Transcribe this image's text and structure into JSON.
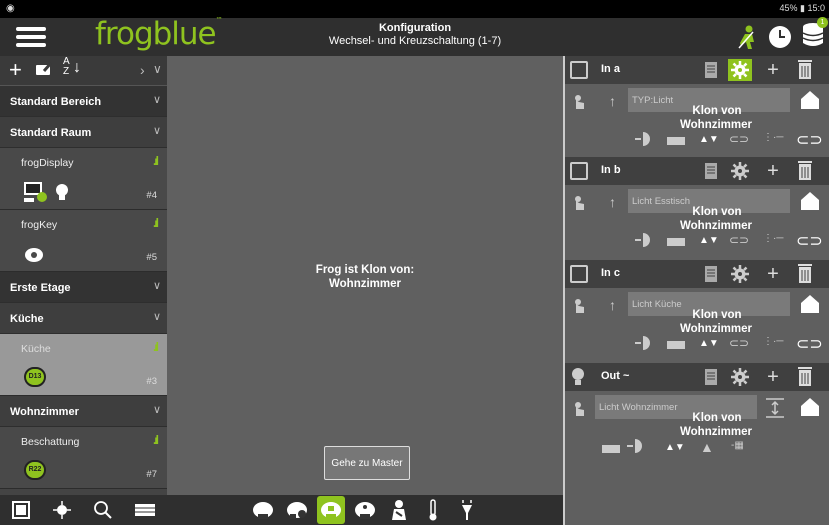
{
  "status": {
    "left_icon": "circle-logo",
    "right": "45% ▮ 15:0"
  },
  "header": {
    "logo": "frogblue",
    "title": "Konfiguration",
    "subtitle": "Wechsel- und Kreuzschaltung (1-7)",
    "badge": "1"
  },
  "sidebar": {
    "sections": [
      {
        "kind": "area",
        "label": "Standard Bereich"
      },
      {
        "kind": "room",
        "label": "Standard Raum"
      },
      {
        "kind": "device",
        "label": "frogDisplay",
        "number": "#4",
        "signal": ".ıl"
      },
      {
        "kind": "device",
        "label": "frogKey",
        "number": "#5",
        "signal": ".ıl"
      },
      {
        "kind": "area",
        "label": "Erste Etage"
      },
      {
        "kind": "room",
        "label": "Küche"
      },
      {
        "kind": "device",
        "label": "Küche",
        "number": "#3",
        "signal": ".ıl",
        "badge": "D13",
        "selected": true
      },
      {
        "kind": "room",
        "label": "Wohnzimmer"
      },
      {
        "kind": "device",
        "label": "Beschattung",
        "number": "#7",
        "signal": ".ıl",
        "badge": "R22"
      }
    ]
  },
  "center": {
    "message_line1": "Frog ist Klon von:",
    "message_line2": "Wohnzimmer",
    "button": "Gehe zu Master"
  },
  "right": {
    "blocks": [
      {
        "name": "In a",
        "field": "TYP:Licht",
        "klon1": "Klon von",
        "klon2": "Wohnzimmer",
        "gear_active": true
      },
      {
        "name": "In b",
        "field": "Licht Esstisch",
        "klon1": "Klon von",
        "klon2": "Wohnzimmer",
        "gear_active": false
      },
      {
        "name": "In c",
        "field": "Licht Küche",
        "klon1": "Klon von",
        "klon2": "Wohnzimmer",
        "gear_active": false
      },
      {
        "name": "Out ~",
        "field": "Licht Wohnzimmer",
        "klon1": "Klon von",
        "klon2": "Wohnzimmer",
        "gear_active": false
      }
    ]
  },
  "colors": {
    "accent": "#8fc31f",
    "header": "#2f2f2f"
  }
}
